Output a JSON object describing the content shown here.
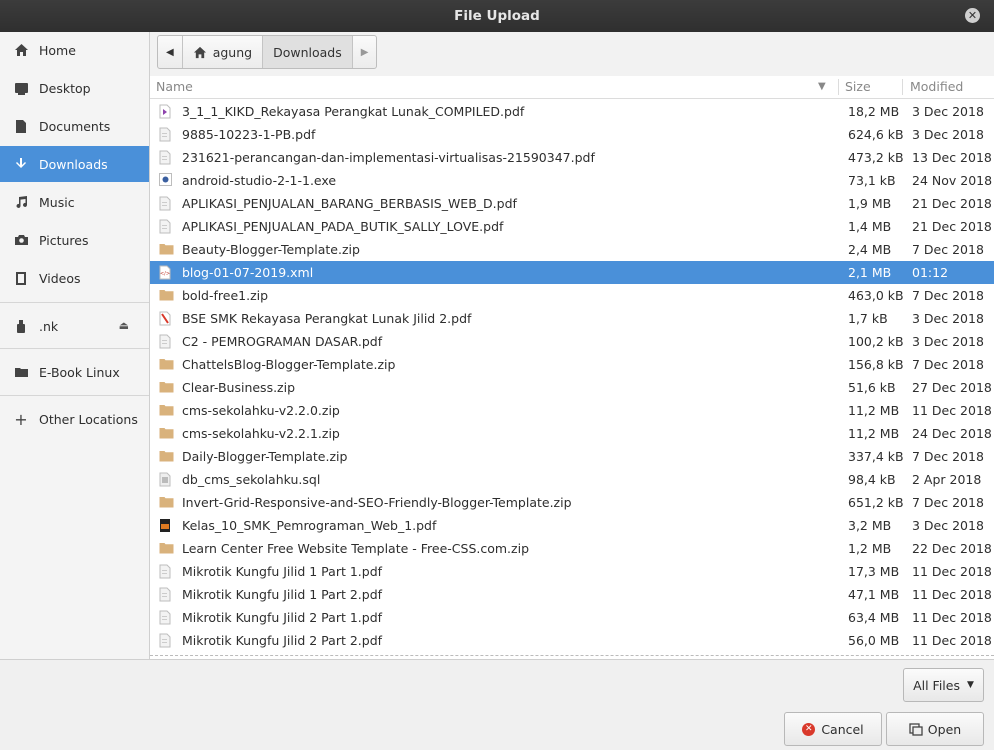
{
  "window": {
    "title": "File Upload"
  },
  "sidebar": {
    "items": [
      {
        "label": "Home",
        "icon": "home-icon"
      },
      {
        "label": "Desktop",
        "icon": "desktop-icon"
      },
      {
        "label": "Documents",
        "icon": "documents-icon"
      },
      {
        "label": "Downloads",
        "icon": "downloads-icon",
        "active": true
      },
      {
        "label": "Music",
        "icon": "music-icon"
      },
      {
        "label": "Pictures",
        "icon": "camera-icon"
      },
      {
        "label": "Videos",
        "icon": "video-icon"
      }
    ],
    "devices": [
      {
        "label": ".nk",
        "icon": "usb-icon",
        "eject": true
      }
    ],
    "bookmarks": [
      {
        "label": "E-Book Linux",
        "icon": "folder-icon"
      }
    ],
    "other": {
      "label": "Other Locations",
      "icon": "plus-icon"
    }
  },
  "pathbar": {
    "segments": [
      "agung",
      "Downloads"
    ],
    "current": "Downloads"
  },
  "columns": {
    "name": "Name",
    "size": "Size",
    "modified": "Modified"
  },
  "files": [
    {
      "name": "3_1_1_KIKD_Rekayasa Perangkat Lunak_COMPILED.pdf",
      "size": "18,2 MB",
      "modified": "3 Dec 2018",
      "type": "pdf"
    },
    {
      "name": "9885-10223-1-PB.pdf",
      "size": "624,6 kB",
      "modified": "3 Dec 2018",
      "type": "doc"
    },
    {
      "name": "231621-perancangan-dan-implementasi-virtualisas-21590347.pdf",
      "size": "473,2 kB",
      "modified": "13 Dec 2018",
      "type": "doc"
    },
    {
      "name": "android-studio-2-1-1.exe",
      "size": "73,1 kB",
      "modified": "24 Nov 2018",
      "type": "exe"
    },
    {
      "name": "APLIKASI_PENJUALAN_BARANG_BERBASIS_WEB_D.pdf",
      "size": "1,9 MB",
      "modified": "21 Dec 2018",
      "type": "doc"
    },
    {
      "name": "APLIKASI_PENJUALAN_PADA_BUTIK_SALLY_LOVE.pdf",
      "size": "1,4 MB",
      "modified": "21 Dec 2018",
      "type": "doc"
    },
    {
      "name": "Beauty-Blogger-Template.zip",
      "size": "2,4 MB",
      "modified": "7 Dec 2018",
      "type": "zip"
    },
    {
      "name": "blog-01-07-2019.xml",
      "size": "2,1 MB",
      "modified": "01:12",
      "type": "xml",
      "selected": true
    },
    {
      "name": "bold-free1.zip",
      "size": "463,0 kB",
      "modified": "7 Dec 2018",
      "type": "zip"
    },
    {
      "name": "BSE SMK Rekayasa Perangkat Lunak Jilid 2.pdf",
      "size": "1,7 kB",
      "modified": "3 Dec 2018",
      "type": "pdfred"
    },
    {
      "name": "C2 - PEMROGRAMAN DASAR.pdf",
      "size": "100,2 kB",
      "modified": "3 Dec 2018",
      "type": "doc"
    },
    {
      "name": "ChattelsBlog-Blogger-Template.zip",
      "size": "156,8 kB",
      "modified": "7 Dec 2018",
      "type": "zip"
    },
    {
      "name": "Clear-Business.zip",
      "size": "51,6 kB",
      "modified": "27 Dec 2018",
      "type": "zip"
    },
    {
      "name": "cms-sekolahku-v2.2.0.zip",
      "size": "11,2 MB",
      "modified": "11 Dec 2018",
      "type": "zip"
    },
    {
      "name": "cms-sekolahku-v2.2.1.zip",
      "size": "11,2 MB",
      "modified": "24 Dec 2018",
      "type": "zip"
    },
    {
      "name": "Daily-Blogger-Template.zip",
      "size": "337,4 kB",
      "modified": "7 Dec 2018",
      "type": "zip"
    },
    {
      "name": "db_cms_sekolahku.sql",
      "size": "98,4 kB",
      "modified": "2 Apr 2018",
      "type": "sql"
    },
    {
      "name": "Invert-Grid-Responsive-and-SEO-Friendly-Blogger-Template.zip",
      "size": "651,2 kB",
      "modified": "7 Dec 2018",
      "type": "zip"
    },
    {
      "name": "Kelas_10_SMK_Pemrograman_Web_1.pdf",
      "size": "3,2 MB",
      "modified": "3 Dec 2018",
      "type": "pdfcolor"
    },
    {
      "name": "Learn Center Free Website Template - Free-CSS.com.zip",
      "size": "1,2 MB",
      "modified": "22 Dec 2018",
      "type": "zip"
    },
    {
      "name": "Mikrotik Kungfu Jilid 1 Part 1.pdf",
      "size": "17,3 MB",
      "modified": "11 Dec 2018",
      "type": "doc"
    },
    {
      "name": "Mikrotik Kungfu Jilid 1 Part 2.pdf",
      "size": "47,1 MB",
      "modified": "11 Dec 2018",
      "type": "doc"
    },
    {
      "name": "Mikrotik Kungfu Jilid 2 Part 1.pdf",
      "size": "63,4 MB",
      "modified": "11 Dec 2018",
      "type": "doc"
    },
    {
      "name": "Mikrotik Kungfu Jilid 2 Part 2.pdf",
      "size": "56,0 MB",
      "modified": "11 Dec 2018",
      "type": "doc"
    }
  ],
  "filter": {
    "label": "All Files"
  },
  "buttons": {
    "cancel": "Cancel",
    "open": "Open"
  },
  "colors": {
    "accent": "#4a90d9",
    "titlebar": "#333333",
    "cancel_icon": "#d9392b"
  }
}
